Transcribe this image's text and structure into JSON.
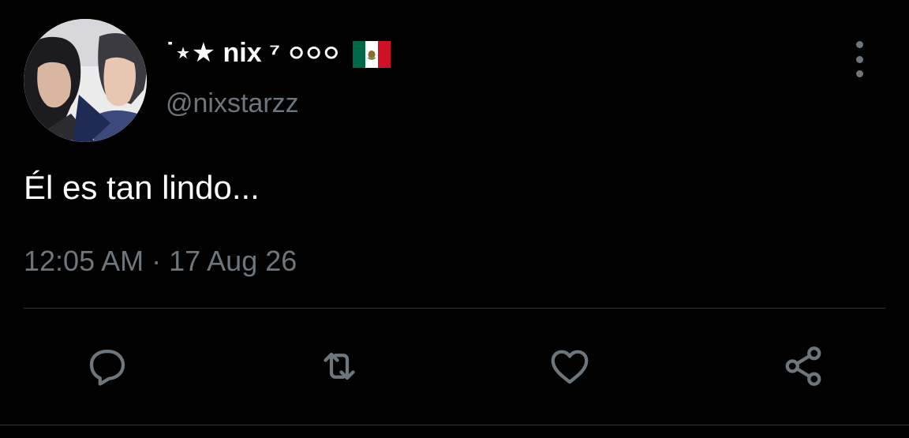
{
  "tweet": {
    "author": {
      "display_name": "˙⋆★ nix ⁷ ০০০",
      "flag_icon": "mexico-flag-icon",
      "handle": "@nixstarzz",
      "avatar_icon": "profile-photo"
    },
    "text": "Él es tan lindo...",
    "meta": "12:05 AM · 17 Aug 26"
  },
  "actions": {
    "reply_icon": "reply-icon",
    "retweet_icon": "retweet-icon",
    "like_icon": "heart-icon",
    "share_icon": "share-icon",
    "more_icon": "more-vertical-icon"
  },
  "colors": {
    "background": "#000000",
    "text_primary": "#ffffff",
    "text_secondary": "#6e767d",
    "divider": "#2f3336"
  }
}
